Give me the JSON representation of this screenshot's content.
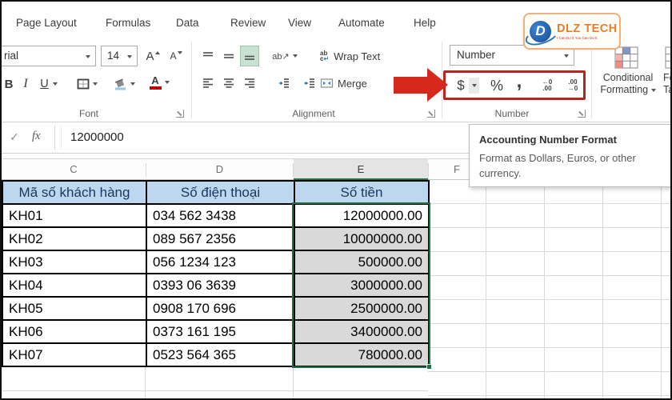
{
  "window": {
    "tabs": [
      "Page Layout",
      "Formulas",
      "Data",
      "Review",
      "View",
      "Automate",
      "Help"
    ]
  },
  "ribbon": {
    "font": {
      "group_label": "Font",
      "name_value": "rial",
      "size_value": "14",
      "bold": "B",
      "italic": "I",
      "underline": "U"
    },
    "alignment": {
      "group_label": "Alignment",
      "orientation": "ab↗",
      "wrap_text": "Wrap Text",
      "merge": "Merge"
    },
    "number": {
      "group_label": "Number",
      "format_value": "Number",
      "currency": "$",
      "percent": "%",
      "comma": ",",
      "inc_top": "←0",
      "inc_bottom": ".00",
      "dec_top": ".00",
      "dec_bottom": "→0"
    },
    "styles": {
      "conditional_l1": "Conditional",
      "conditional_l2": "Formatting",
      "table_l1": "For",
      "table_l2": "Ta"
    }
  },
  "icons": {
    "letter_a": "A",
    "wrap_top": "ab",
    "wrap_c": "c",
    "wrap_arrow": "↵"
  },
  "logo": {
    "monogram": "D",
    "brand": "DLZ TECH",
    "tagline": "I Can Do It You Can Do It"
  },
  "formula_bar": {
    "check": "✓",
    "fx": "fx",
    "value": "12000000"
  },
  "tooltip": {
    "title": "Accounting Number Format",
    "line1": "Format as Dollars, Euros, or other",
    "line2": "currency."
  },
  "sheet": {
    "columns": [
      "C",
      "D",
      "E",
      "F"
    ],
    "header": {
      "customer": "Mã số khách hàng",
      "phone": "Số điện thoại",
      "amount": "Số tiền"
    },
    "rows": [
      {
        "code": "KH01",
        "phone": "034 562 3438",
        "amount": "12000000.00"
      },
      {
        "code": "KH02",
        "phone": "089 567 2356",
        "amount": "10000000.00"
      },
      {
        "code": "KH03",
        "phone": "056 1234 123",
        "amount": "500000.00"
      },
      {
        "code": "KH04",
        "phone": "0393 06 3639",
        "amount": "3000000.00"
      },
      {
        "code": "KH05",
        "phone": "0908 170 696",
        "amount": "2500000.00"
      },
      {
        "code": "KH06",
        "phone": "0373 161 195",
        "amount": "3400000.00"
      },
      {
        "code": "KH07",
        "phone": "0523 564 365",
        "amount": "780000.00"
      }
    ]
  },
  "colors": {
    "accent_green": "#217346",
    "table_header_fill": "#bdd7ee",
    "selection_fill": "#d9d9d9",
    "highlight_box_red": "#b3281e",
    "arrow_red": "#d6281c",
    "logo_orange": "#e87d2b",
    "logo_blue": "#17498f"
  }
}
